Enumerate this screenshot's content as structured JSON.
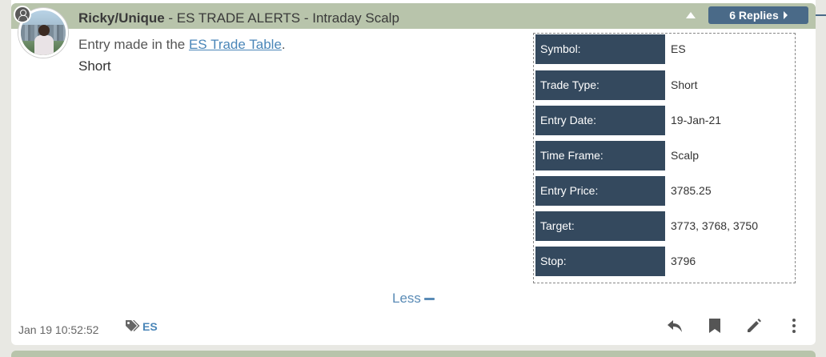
{
  "post": {
    "author": "Ricky/Unique",
    "title_rest": " - ES TRADE ALERTS - Intraday Scalp",
    "replies_label": "6 Replies",
    "entry_prefix": "Entry made in the ",
    "entry_link": "ES Trade Table",
    "entry_suffix": ".",
    "body_text": "Short",
    "less_label": "Less",
    "timestamp": "Jan 19 10:52:52",
    "tag": "ES"
  },
  "trade_table": [
    {
      "label": "Symbol:",
      "value": "ES"
    },
    {
      "label": "Trade Type:",
      "value": "Short"
    },
    {
      "label": "Entry Date:",
      "value": "19-Jan-21"
    },
    {
      "label": "Time Frame:",
      "value": "Scalp"
    },
    {
      "label": "Entry Price:",
      "value": "3785.25"
    },
    {
      "label": "Target:",
      "value": "3773, 3768, 3750"
    },
    {
      "label": "Stop:",
      "value": "3796"
    }
  ],
  "icons": {
    "collapse": "caret-up-icon",
    "user": "user-icon",
    "tag": "tag-icon",
    "reply": "reply-icon",
    "bookmark": "bookmark-icon",
    "edit": "pencil-icon",
    "more": "more-vertical-icon"
  },
  "colors": {
    "header_bg": "#b8c4ab",
    "replies_bg": "#4a6a88",
    "label_bg": "#34495e",
    "link": "#4a86b8"
  }
}
